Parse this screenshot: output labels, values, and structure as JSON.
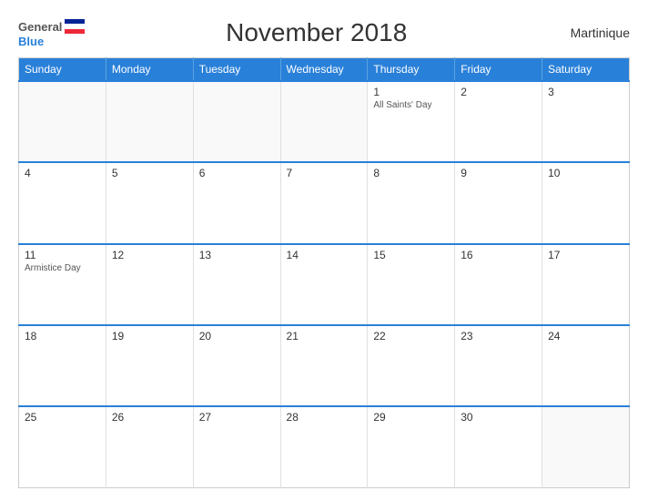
{
  "header": {
    "logo": {
      "general": "General",
      "blue": "Blue",
      "flag_alt": "GeneralBlue logo flag"
    },
    "title": "November 2018",
    "region": "Martinique"
  },
  "calendar": {
    "weekdays": [
      "Sunday",
      "Monday",
      "Tuesday",
      "Wednesday",
      "Thursday",
      "Friday",
      "Saturday"
    ],
    "weeks": [
      [
        {
          "day": "",
          "holiday": ""
        },
        {
          "day": "",
          "holiday": ""
        },
        {
          "day": "",
          "holiday": ""
        },
        {
          "day": "",
          "holiday": ""
        },
        {
          "day": "1",
          "holiday": "All Saints' Day"
        },
        {
          "day": "2",
          "holiday": ""
        },
        {
          "day": "3",
          "holiday": ""
        }
      ],
      [
        {
          "day": "4",
          "holiday": ""
        },
        {
          "day": "5",
          "holiday": ""
        },
        {
          "day": "6",
          "holiday": ""
        },
        {
          "day": "7",
          "holiday": ""
        },
        {
          "day": "8",
          "holiday": ""
        },
        {
          "day": "9",
          "holiday": ""
        },
        {
          "day": "10",
          "holiday": ""
        }
      ],
      [
        {
          "day": "11",
          "holiday": "Armistice Day"
        },
        {
          "day": "12",
          "holiday": ""
        },
        {
          "day": "13",
          "holiday": ""
        },
        {
          "day": "14",
          "holiday": ""
        },
        {
          "day": "15",
          "holiday": ""
        },
        {
          "day": "16",
          "holiday": ""
        },
        {
          "day": "17",
          "holiday": ""
        }
      ],
      [
        {
          "day": "18",
          "holiday": ""
        },
        {
          "day": "19",
          "holiday": ""
        },
        {
          "day": "20",
          "holiday": ""
        },
        {
          "day": "21",
          "holiday": ""
        },
        {
          "day": "22",
          "holiday": ""
        },
        {
          "day": "23",
          "holiday": ""
        },
        {
          "day": "24",
          "holiday": ""
        }
      ],
      [
        {
          "day": "25",
          "holiday": ""
        },
        {
          "day": "26",
          "holiday": ""
        },
        {
          "day": "27",
          "holiday": ""
        },
        {
          "day": "28",
          "holiday": ""
        },
        {
          "day": "29",
          "holiday": ""
        },
        {
          "day": "30",
          "holiday": ""
        },
        {
          "day": "",
          "holiday": ""
        }
      ]
    ]
  }
}
